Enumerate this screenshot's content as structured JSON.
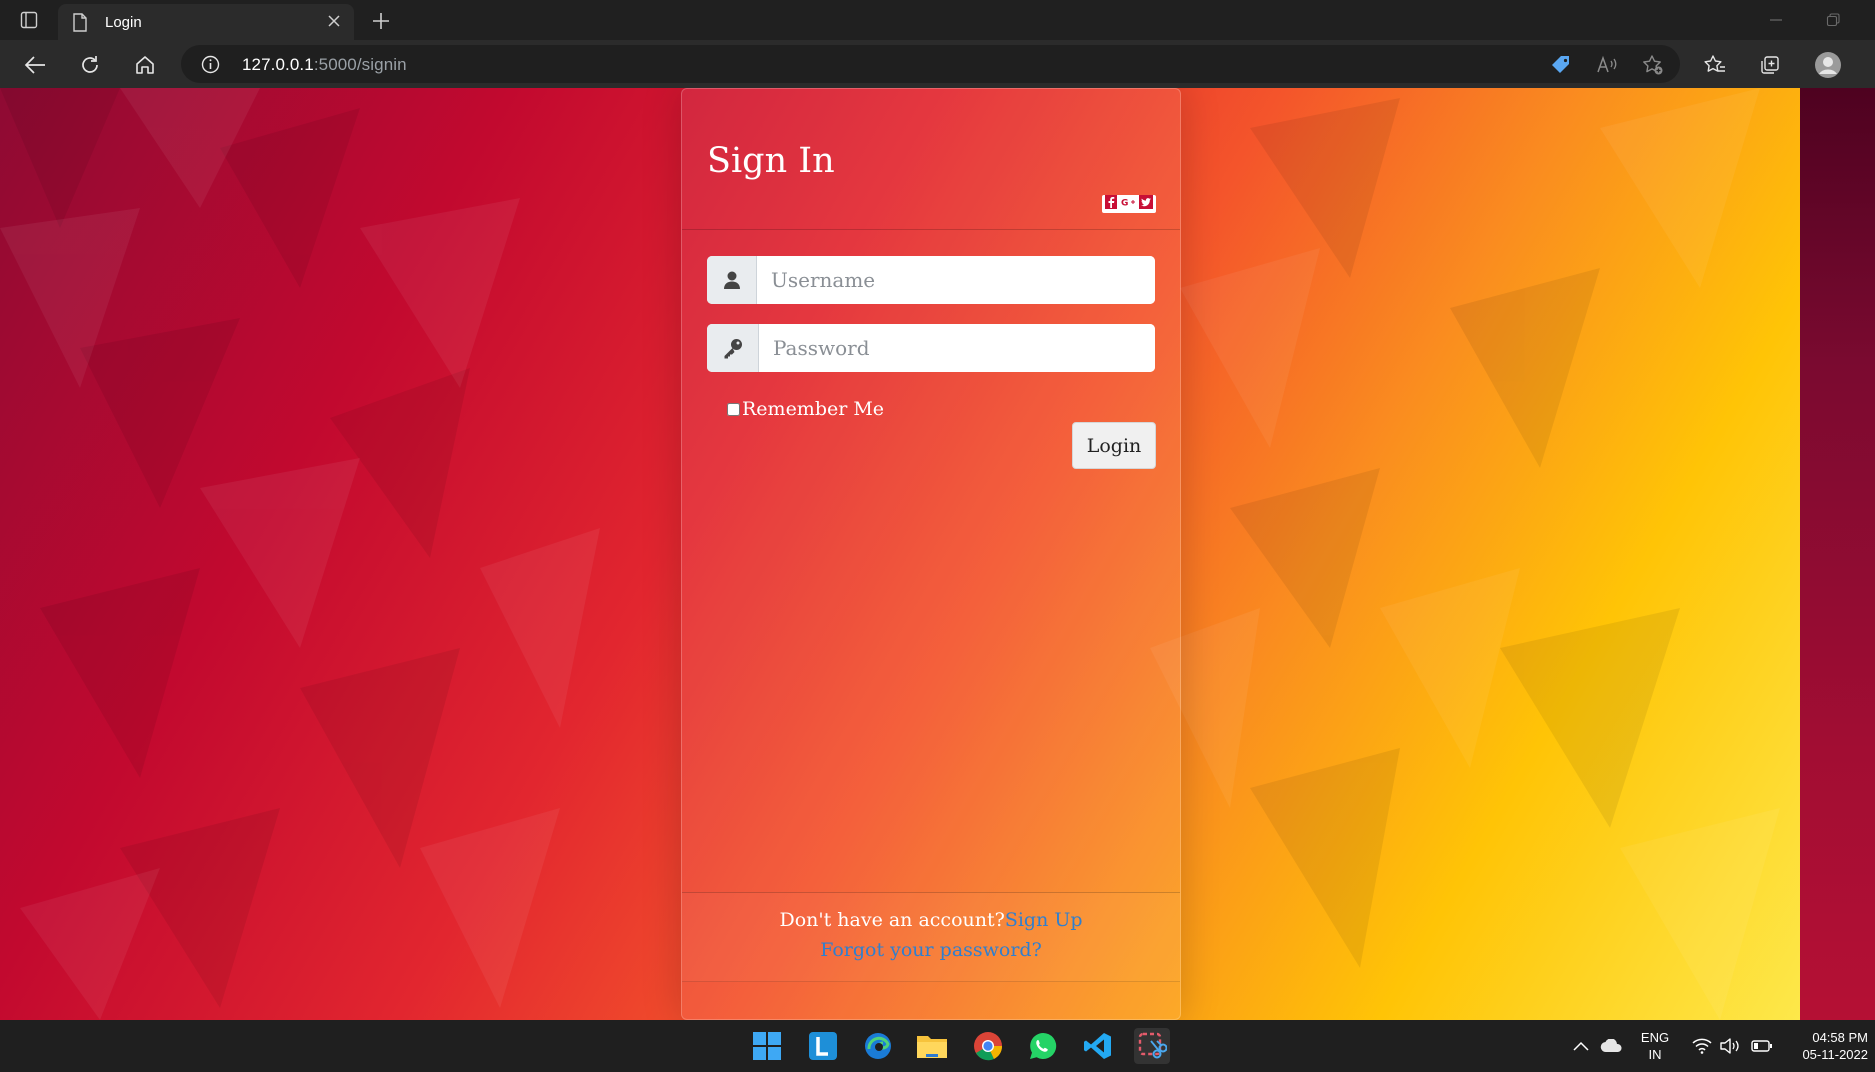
{
  "browser": {
    "tab_title": "Login",
    "url_host": "127.0.0.1",
    "url_path": ":5000/signin"
  },
  "card": {
    "title": "Sign In",
    "username_placeholder": "Username",
    "password_placeholder": "Password",
    "remember_label": "Remember Me",
    "login_label": "Login",
    "footer_text": "Don't have an account?",
    "signup_link": "Sign Up",
    "forgot_link": "Forgot your password?"
  },
  "taskbar": {
    "language_line1": "ENG",
    "language_line2": "IN",
    "time": "04:58 PM",
    "date": "05-11-2022"
  },
  "colors": {
    "link": "#2f7fcf",
    "button_bg": "#f0f0f0"
  },
  "icons": [
    "user-icon",
    "key-icon",
    "facebook-icon",
    "google-plus-icon",
    "twitter-icon"
  ]
}
